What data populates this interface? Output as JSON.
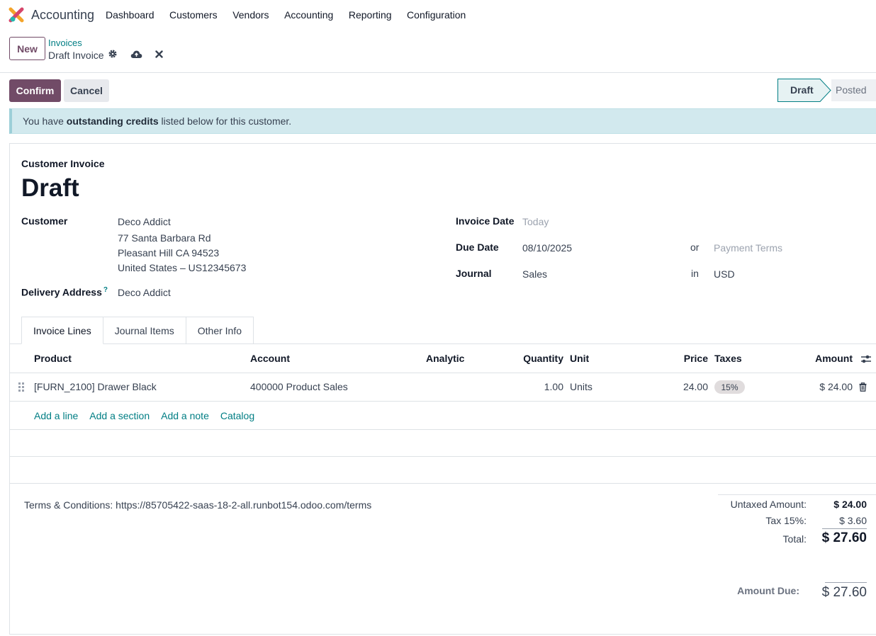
{
  "app": {
    "name": "Accounting"
  },
  "menu": [
    "Dashboard",
    "Customers",
    "Vendors",
    "Accounting",
    "Reporting",
    "Configuration"
  ],
  "control": {
    "new_label": "New",
    "breadcrumb_parent": "Invoices",
    "breadcrumb_current": "Draft Invoice"
  },
  "actions": {
    "confirm": "Confirm",
    "cancel": "Cancel"
  },
  "status": {
    "draft": "Draft",
    "posted": "Posted",
    "current": "Draft"
  },
  "alert": {
    "prefix": "You have ",
    "strong": "outstanding credits",
    "suffix": " listed below for this customer."
  },
  "invoice": {
    "type": "Customer Invoice",
    "name": "Draft",
    "customer_label": "Customer",
    "customer_name": "Deco Addict",
    "address_line1": "77 Santa Barbara Rd",
    "address_line2": "Pleasant Hill CA 94523",
    "address_line3": "United States – US12345673",
    "delivery_label": "Delivery Address",
    "delivery_help": "?",
    "delivery_value": "Deco Addict",
    "invoice_date_label": "Invoice Date",
    "invoice_date_placeholder": "Today",
    "due_date_label": "Due Date",
    "due_date_value": "08/10/2025",
    "or_label": "or",
    "payment_terms_placeholder": "Payment Terms",
    "journal_label": "Journal",
    "journal_value": "Sales",
    "in_label": "in",
    "currency_value": "USD"
  },
  "tabs": [
    "Invoice Lines",
    "Journal Items",
    "Other Info"
  ],
  "table": {
    "headers": {
      "product": "Product",
      "account": "Account",
      "analytic": "Analytic",
      "quantity": "Quantity",
      "unit": "Unit",
      "price": "Price",
      "taxes": "Taxes",
      "amount": "Amount"
    },
    "rows": [
      {
        "product": "[FURN_2100] Drawer Black",
        "account": "400000 Product Sales",
        "analytic": "",
        "quantity": "1.00",
        "unit": "Units",
        "price": "24.00",
        "tax": "15%",
        "amount": "$ 24.00"
      }
    ],
    "add_links": [
      "Add a line",
      "Add a section",
      "Add a note",
      "Catalog"
    ]
  },
  "footer": {
    "terms": "Terms & Conditions: https://85705422-saas-18-2-all.runbot154.odoo.com/terms",
    "untaxed_label": "Untaxed Amount:",
    "untaxed_value": "$ 24.00",
    "tax_label": "Tax 15%:",
    "tax_value": "$ 3.60",
    "total_label": "Total:",
    "total_value": "$ 27.60",
    "due_label": "Amount Due:",
    "due_value": "$ 27.60"
  },
  "colors": {
    "brand": "#714b67",
    "link": "#017e84",
    "alert_bg": "#d2e9ee"
  }
}
